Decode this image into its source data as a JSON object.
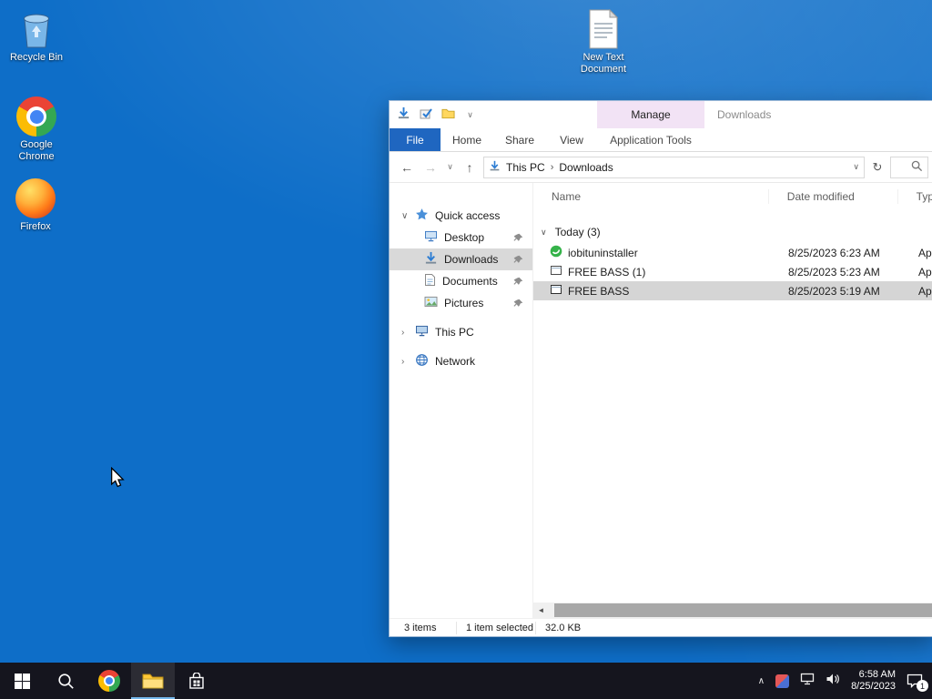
{
  "colors": {
    "desktop_blue": "#0e6ec8",
    "manage_tab_purple": "#f2e3f5",
    "file_tab_blue": "#1f66c0",
    "selection_gray": "#d9d9d9",
    "taskbar_dark": "#15151e"
  },
  "icons": {
    "back": "←",
    "forward": "→",
    "up": "↑",
    "refresh": "↻",
    "dropdown": "∨",
    "breadcrumb_sep": "›",
    "expanded": "∨",
    "collapsed": "›",
    "scroll_left": "◄",
    "tray_chevron": "∧"
  },
  "desktop": {
    "icons": {
      "recycle_bin": "Recycle Bin",
      "chrome": "Google Chrome",
      "firefox": "Firefox",
      "new_text": "New Text Document"
    }
  },
  "explorer": {
    "titlebar": {
      "manage_label": "Manage",
      "window_title": "Downloads"
    },
    "ribbon": {
      "file": "File",
      "home": "Home",
      "share": "Share",
      "view": "View",
      "application_tools": "Application Tools"
    },
    "address": {
      "crumb_this_pc": "This PC",
      "crumb_downloads": "Downloads"
    },
    "sidebar": {
      "quick_access": "Quick access",
      "desktop": "Desktop",
      "downloads": "Downloads",
      "documents": "Documents",
      "pictures": "Pictures",
      "this_pc": "This PC",
      "network": "Network"
    },
    "list": {
      "col_name": "Name",
      "col_date": "Date modified",
      "col_type": "Typ",
      "group_label": "Today (3)",
      "files": [
        {
          "name": "iobituninstaller",
          "date": "8/25/2023 6:23 AM",
          "type": "Ap"
        },
        {
          "name": "FREE BASS (1)",
          "date": "8/25/2023 5:23 AM",
          "type": "Ap"
        },
        {
          "name": "FREE BASS",
          "date": "8/25/2023 5:19 AM",
          "type": "Ap"
        }
      ]
    },
    "status": {
      "item_count": "3 items",
      "selection": "1 item selected",
      "size": "32.0 KB"
    }
  },
  "taskbar": {
    "clock_time": "6:58 AM",
    "clock_date": "8/25/2023",
    "notification_badge": "1"
  }
}
